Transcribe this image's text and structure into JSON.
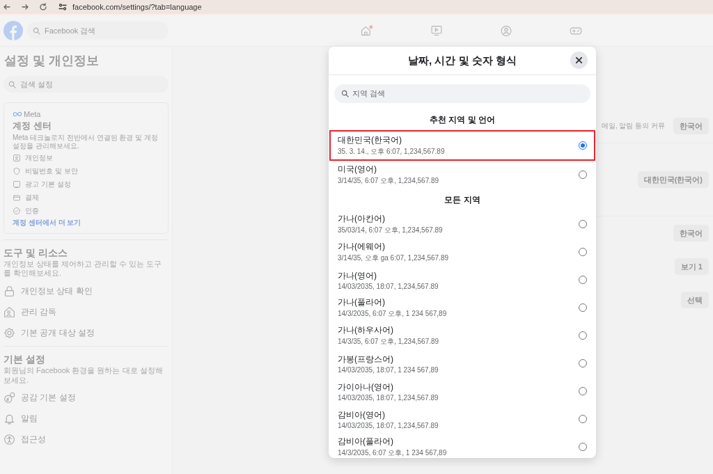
{
  "browser": {
    "url": "facebook.com/settings/?tab=language"
  },
  "topbar": {
    "search_placeholder": "Facebook 검색"
  },
  "sidebar": {
    "title": "설정 및 개인정보",
    "search_placeholder": "검색 설정",
    "account_center": {
      "brand": "Meta",
      "title": "계정 센터",
      "description": "Meta 테크놀로지 전반에서 연결된 환경 및 계정 설정을 관리해보세요.",
      "items": [
        {
          "kind": "id",
          "label": "개인정보"
        },
        {
          "kind": "shield",
          "label": "비밀번호 및 보안"
        },
        {
          "kind": "screen",
          "label": "광고 기본 설정"
        },
        {
          "kind": "card",
          "label": "결제"
        },
        {
          "kind": "check",
          "label": "인증"
        }
      ],
      "link": "계정 센터에서 더 보기"
    },
    "sections": [
      {
        "title": "도구 및 리소스",
        "description": "개인정보 상태를 제어하고 관리할 수 있는 도구를 확인해보세요.",
        "items": [
          {
            "kind": "lock",
            "label": "개인정보 상태 확인"
          },
          {
            "kind": "house",
            "label": "관리 감독"
          },
          {
            "kind": "gear",
            "label": "기본 공개 대상 설정"
          }
        ]
      },
      {
        "title": "기본 설정",
        "description": "회원님의 Facebook 환경을 원하는 대로 설정해보세요.",
        "items": [
          {
            "kind": "reaction",
            "label": "공감 기본 설정"
          },
          {
            "kind": "bell",
            "label": "알림"
          },
          {
            "kind": "access",
            "label": "접근성"
          }
        ]
      }
    ]
  },
  "main": {
    "rows": [
      {
        "text": "메일, 알림 등의 커뮤",
        "button": "한국어"
      },
      {
        "button": "대한민국(한국어)"
      },
      {
        "button": "한국어"
      },
      {
        "button": "보기 1"
      },
      {
        "button": "선택"
      }
    ]
  },
  "modal": {
    "title": "날짜, 시간 및 숫자 형식",
    "search_placeholder": "지역 검색",
    "groups": [
      {
        "heading": "추천 지역 및 언어",
        "options": [
          {
            "name": "대한민국(한국어)",
            "format": "35. 3. 14., 오후 6:07, 1,234,567.89",
            "selected": true,
            "highlighted": true
          },
          {
            "name": "미국(영어)",
            "format": "3/14/35, 6:07 오후, 1,234,567.89",
            "selected": false,
            "highlighted": false
          }
        ]
      },
      {
        "heading": "모든 지역",
        "options": [
          {
            "name": "가나(아칸어)",
            "format": "35/03/14, 6:07 오후, 1,234,567.89",
            "selected": false,
            "highlighted": false
          },
          {
            "name": "가나(에웨어)",
            "format": "3/14/35, 오후 ga 6:07, 1,234,567.89",
            "selected": false,
            "highlighted": false
          },
          {
            "name": "가나(영어)",
            "format": "14/03/2035, 18:07, 1,234,567.89",
            "selected": false,
            "highlighted": false
          },
          {
            "name": "가나(풀라어)",
            "format": "14/3/2035, 6:07 오후, 1 234 567,89",
            "selected": false,
            "highlighted": false
          },
          {
            "name": "가나(하우사어)",
            "format": "14/3/35, 6:07 오후, 1,234,567.89",
            "selected": false,
            "highlighted": false
          },
          {
            "name": "가봉(프랑스어)",
            "format": "14/03/2035, 18:07, 1 234 567,89",
            "selected": false,
            "highlighted": false
          },
          {
            "name": "가이아나(영어)",
            "format": "14/03/2035, 18:07, 1,234,567.89",
            "selected": false,
            "highlighted": false
          },
          {
            "name": "감비아(영어)",
            "format": "14/03/2035, 18:07, 1,234,567.89",
            "selected": false,
            "highlighted": false
          },
          {
            "name": "감비아(풀라어)",
            "format": "14/3/2035, 6:07 오후, 1 234 567,89",
            "selected": false,
            "highlighted": false
          }
        ]
      }
    ]
  }
}
